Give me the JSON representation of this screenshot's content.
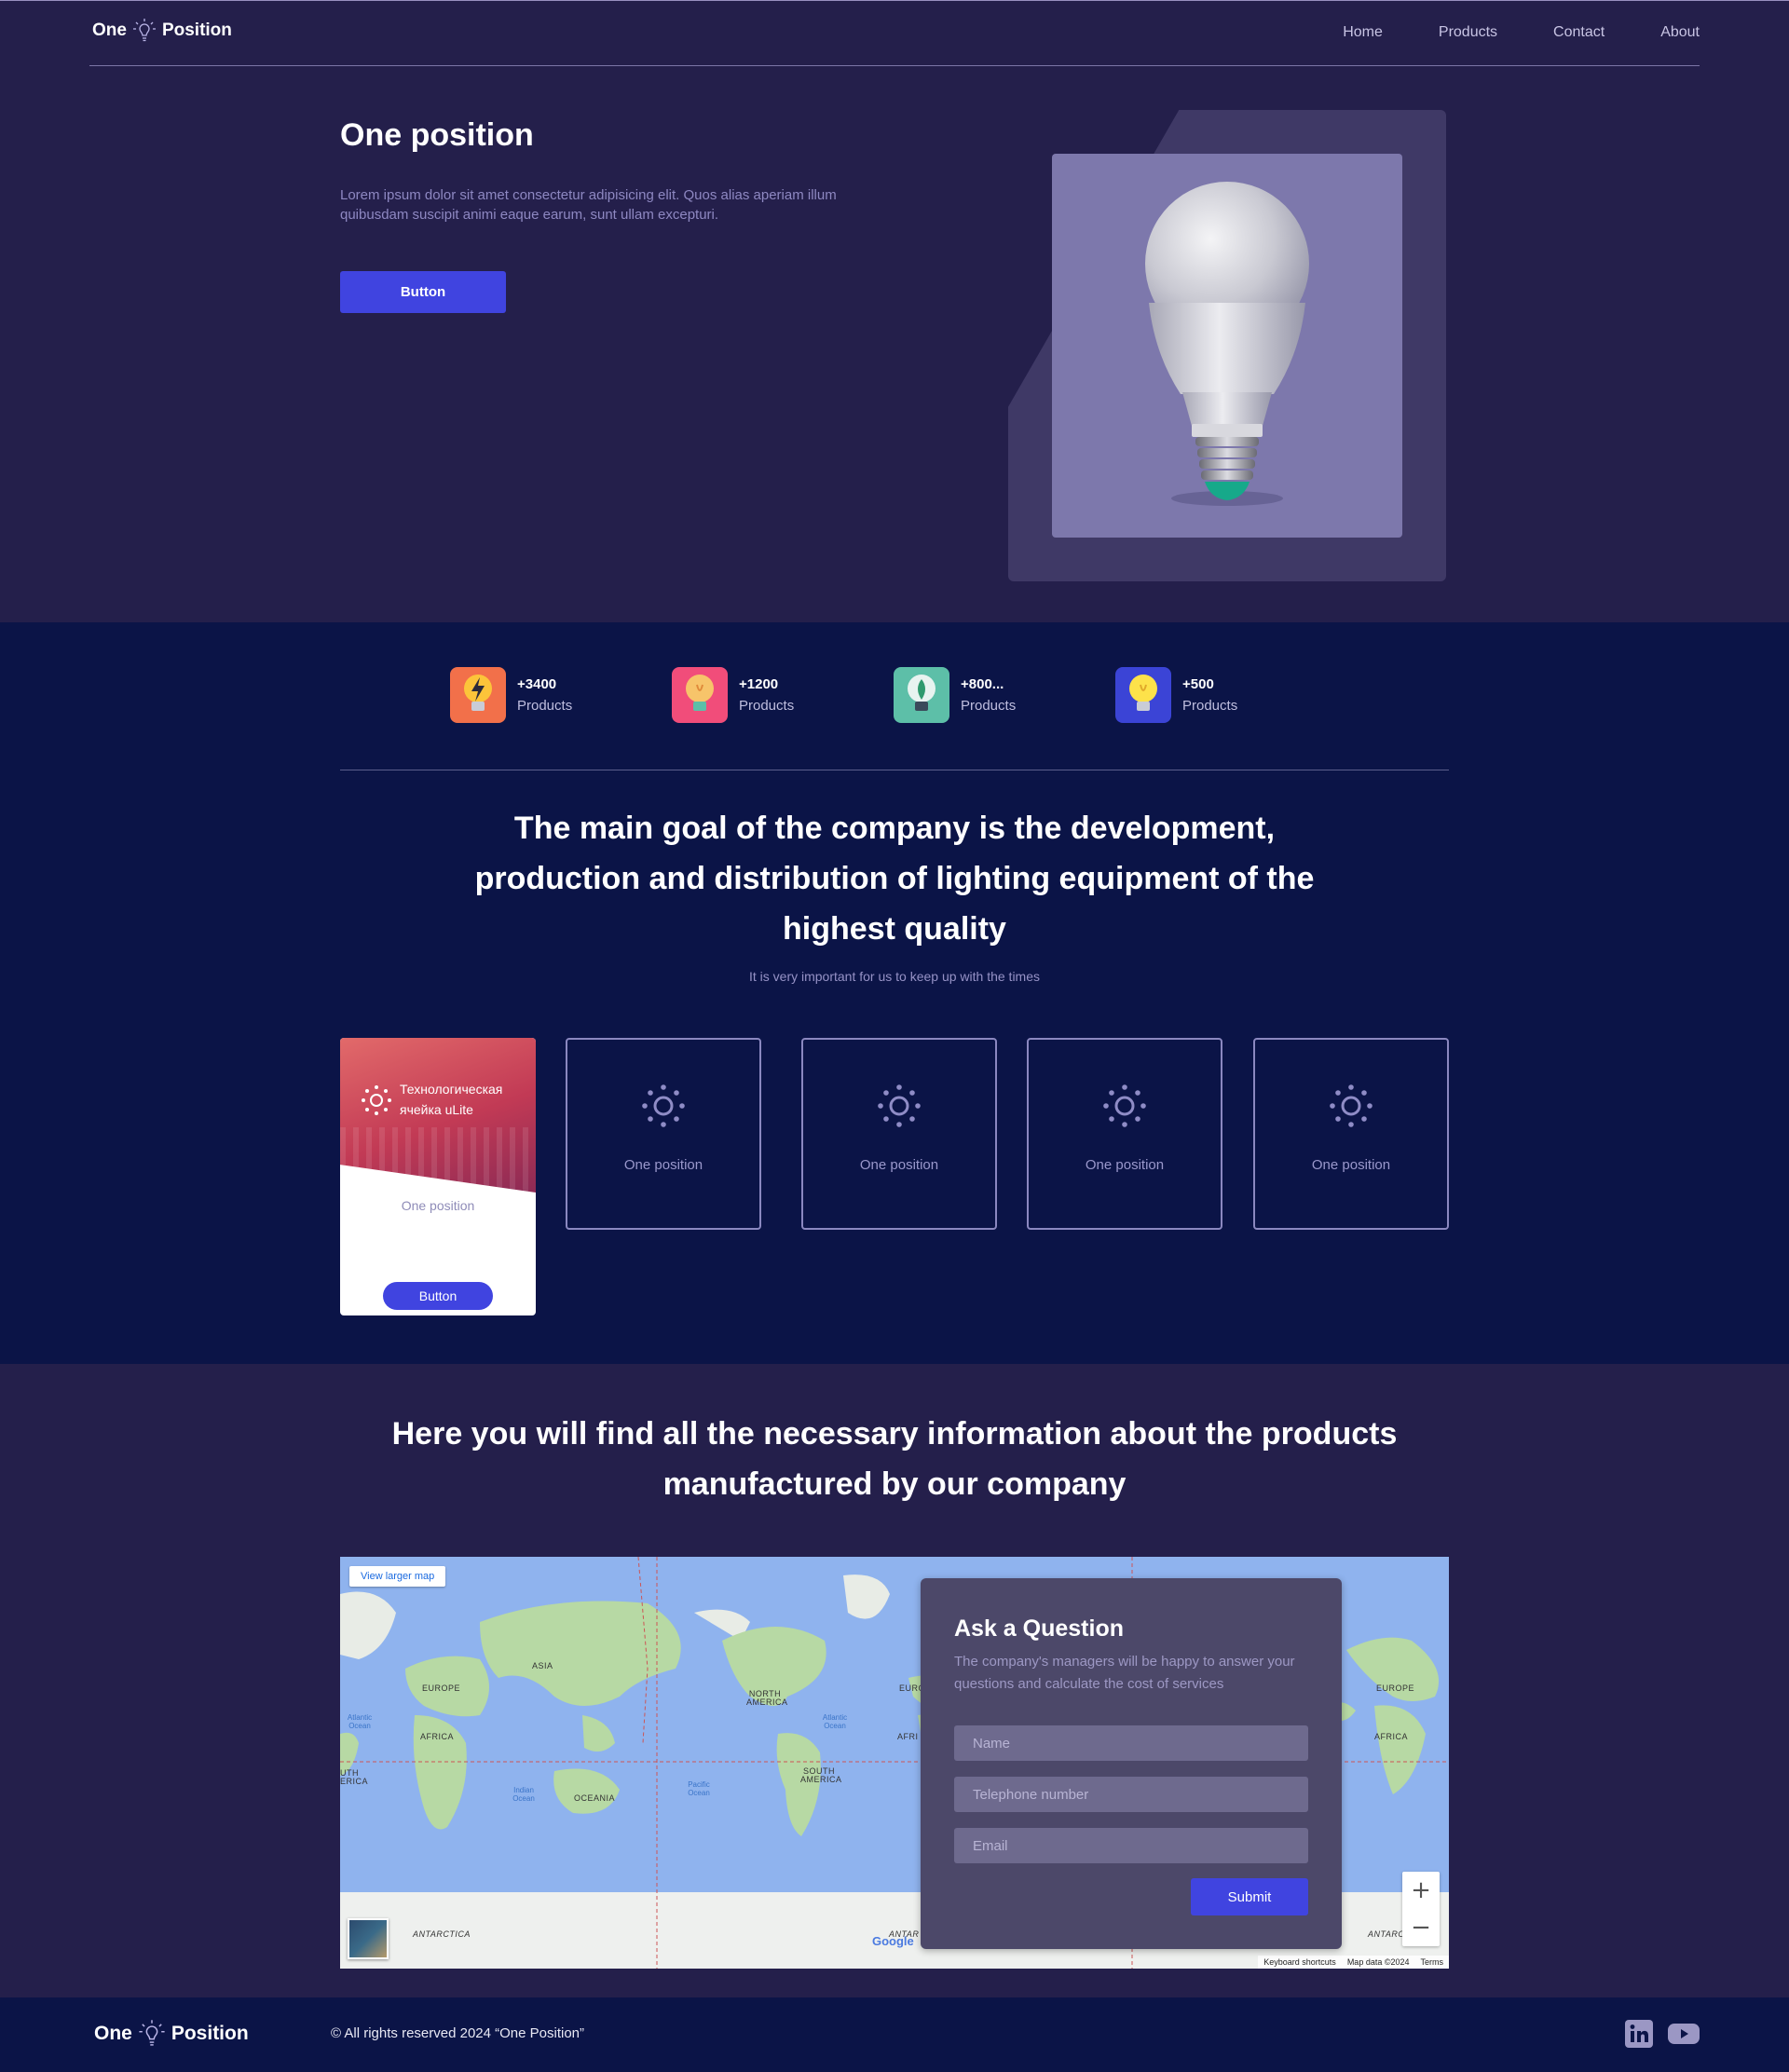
{
  "header": {
    "logo_left": "One",
    "logo_right": "Position",
    "nav": [
      "Home",
      "Products",
      "Contact",
      "About"
    ]
  },
  "hero": {
    "title": "One position",
    "text": "Lorem ipsum dolor sit amet consectetur adipisicing elit. Quos alias aperiam illum quibusdam suscipit animi eaque earum, sunt ullam excepturi.",
    "button": "Button",
    "image_icon": "light-bulb-image"
  },
  "stats": [
    {
      "value": "+3400",
      "label": "Products",
      "icon": "lightning-bulb-icon",
      "color": "#f2704a"
    },
    {
      "value": "+1200",
      "label": "Products",
      "icon": "bulb-icon",
      "color": "#f14d7a"
    },
    {
      "value": "+800...",
      "label": "Products",
      "icon": "leaf-bulb-icon",
      "color": "#5dbfa8"
    },
    {
      "value": "+500",
      "label": "Products",
      "icon": "yellow-bulb-icon",
      "color": "#3b44d6"
    }
  ],
  "goal": {
    "title": "The main goal of the company is the development, production and distribution of lighting equipment of the highest quality",
    "subtitle": "It is very important for us to keep up with the times"
  },
  "feature_card": {
    "photo_title": "Технологическая ячейка uLite",
    "caption": "One position",
    "button": "Button"
  },
  "outline_cards": [
    "One position",
    "One position",
    "One position",
    "One position"
  ],
  "info": {
    "title": "Here you will find all the necessary information about the products manufactured by our company"
  },
  "map": {
    "view_larger": "View larger map",
    "continents": [
      "ASIA",
      "EUROPE",
      "AFRICA",
      "OCEANIA",
      "NORTH AMERICA",
      "SOUTH AMERICA",
      "ANTARCTICA",
      "EUROPE",
      "AFRICA",
      "ANTARC",
      "ANTAR",
      "EURO",
      "AFRI",
      "UTH ERICA"
    ],
    "oceans": [
      "Atlantic Ocean",
      "Indian Ocean",
      "Pacific Ocean",
      "Atlantic Ocean"
    ],
    "google": "Google",
    "footer": [
      "Keyboard shortcuts",
      "Map data ©2024",
      "Terms"
    ],
    "zoom_in": "+",
    "zoom_out": "−"
  },
  "form": {
    "title": "Ask a Question",
    "subtitle": "The company's managers will be happy to answer your questions and calculate the cost of services",
    "name_placeholder": "Name",
    "phone_placeholder": "Telephone number",
    "email_placeholder": "Email",
    "submit": "Submit"
  },
  "footer": {
    "logo_left": "One",
    "logo_right": "Position",
    "copyright": "© All rights reserved 2024 “One Position”",
    "social": [
      "linkedin-icon",
      "youtube-icon"
    ]
  },
  "colors": {
    "bg": "#241f4b",
    "dark": "#0b1447",
    "accent": "#4044e0"
  }
}
